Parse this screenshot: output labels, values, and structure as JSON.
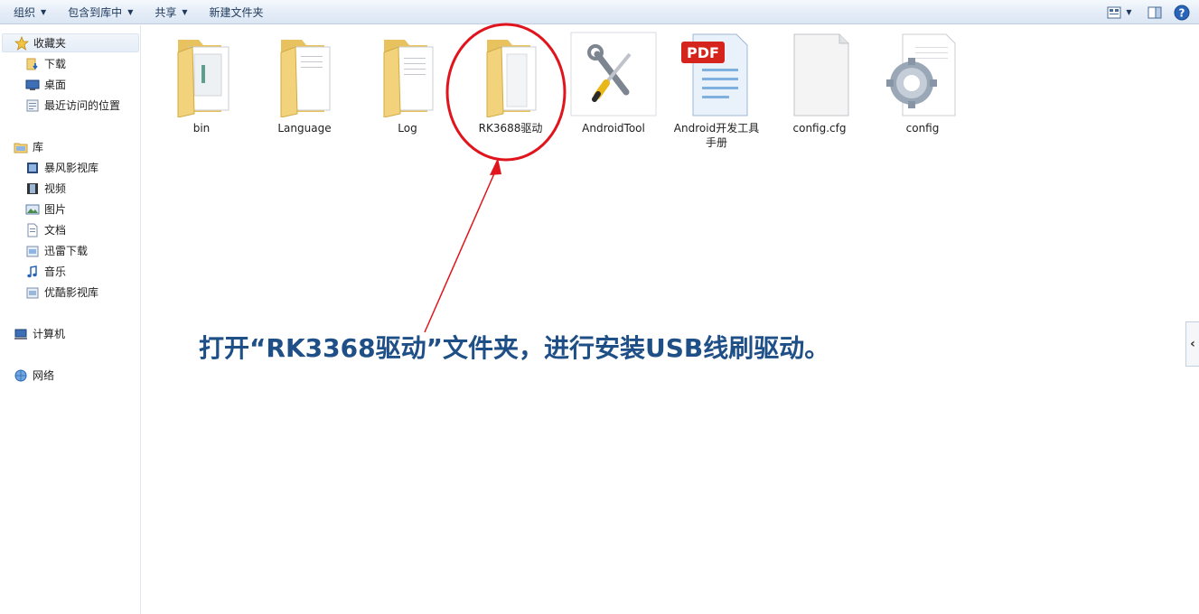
{
  "toolbar": {
    "organize": "组织",
    "include_in_library": "包含到库中",
    "share": "共享",
    "new_folder": "新建文件夹"
  },
  "nav": {
    "favorites": {
      "label": "收藏夹",
      "items": [
        "下载",
        "桌面",
        "最近访问的位置"
      ]
    },
    "libraries": {
      "label": "库",
      "items": [
        "暴风影视库",
        "视频",
        "图片",
        "文档",
        "迅雷下载",
        "音乐",
        "优酷影视库"
      ]
    },
    "computer": "计算机",
    "network": "网络"
  },
  "files": [
    {
      "name": "bin",
      "type": "folder"
    },
    {
      "name": "Language",
      "type": "folder"
    },
    {
      "name": "Log",
      "type": "folder"
    },
    {
      "name": "RK3688驱动",
      "type": "folder"
    },
    {
      "name": "AndroidTool",
      "type": "tool"
    },
    {
      "name": "Android开发工具手册",
      "type": "pdf",
      "badge": "PDF"
    },
    {
      "name": "config.cfg",
      "type": "blank"
    },
    {
      "name": "config",
      "type": "settings"
    }
  ],
  "annotation": "打开“RK3368驱动”文件夹，进行安装USB线刷驱动。",
  "colors": {
    "annotation": "#1f4f87",
    "highlight_circle": "#e0141c",
    "folder": "#f2d27a"
  }
}
